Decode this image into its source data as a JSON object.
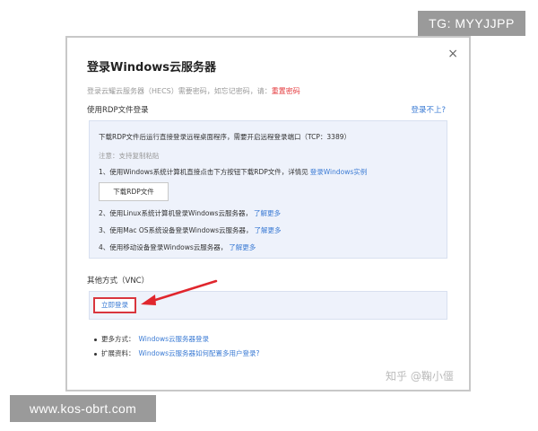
{
  "badges": {
    "tg": "TG: MYYJJPP",
    "url": "www.kos-obrt.com"
  },
  "dialog": {
    "title": "登录Windows云服务器",
    "close_icon": "×",
    "hint_prefix": "登录云耀云服务器（HECS）需要密码，如忘记密码，请：",
    "hint_link": "重置密码",
    "rdp_label": "使用RDP文件登录",
    "trouble_link": "登录不上?",
    "rdp": {
      "desc": "下载RDP文件后运行直接登录远程桌面程序，需要开启远程登录端口（TCP：3389）",
      "note": "注意：支持复制粘贴",
      "step1": "1、使用Windows系统计算机直接点击下方按钮下载RDP文件，详情见",
      "step1_link": "登录Windows实例",
      "download_btn": "下载RDP文件",
      "step2": "2、使用Linux系统计算机登录Windows云服务器，",
      "step2_link": "了解更多",
      "step3": "3、使用Mac OS系统设备登录Windows云服务器，",
      "step3_link": "了解更多",
      "step4": "4、使用移动设备登录Windows云服务器，",
      "step4_link": "了解更多"
    },
    "vnc_label": "其他方式（VNC）",
    "vnc_btn": "立即登录",
    "more": {
      "more_label": "更多方式：",
      "more_link": "Windows云服务器登录",
      "ext_label": "扩展资料：",
      "ext_link": "Windows云服务器如何配置多用户登录?"
    },
    "watermark": "知乎 @鞠小僵"
  },
  "colors": {
    "link": "#3b7bd4",
    "danger": "#e4393c",
    "panel": "#eef2fb"
  }
}
